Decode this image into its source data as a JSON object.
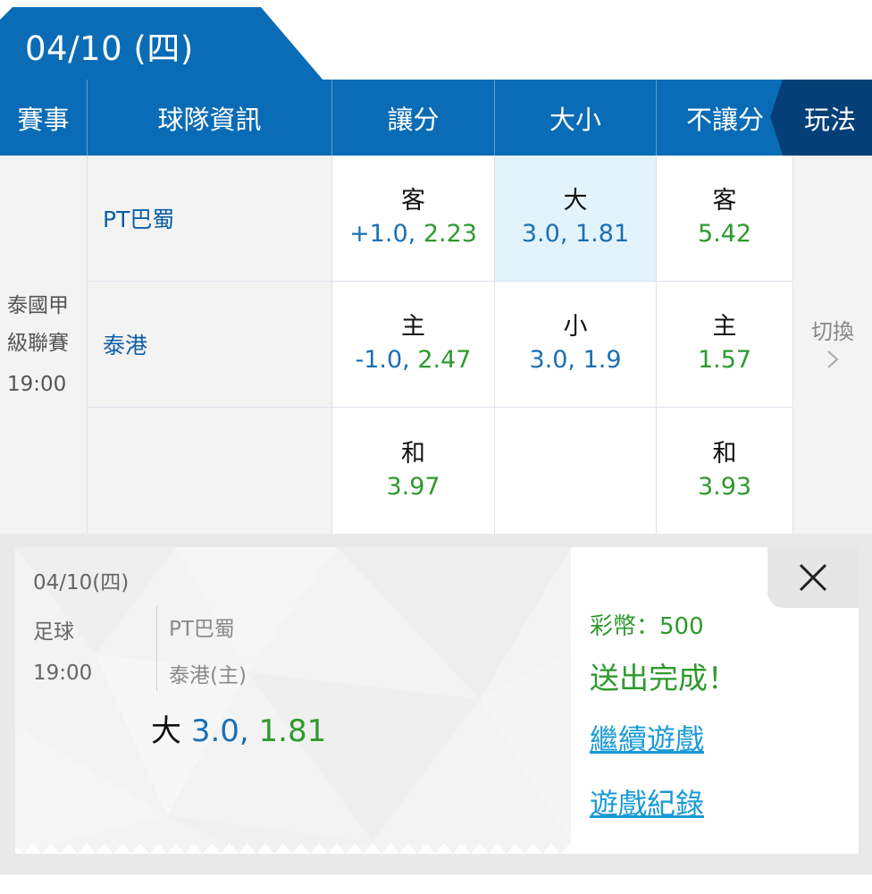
{
  "date_tab": {
    "label": "04/10 (四)"
  },
  "header": {
    "col_event": "賽事",
    "col_team": "球隊資訊",
    "col_handicap": "讓分",
    "col_total": "大小",
    "col_moneyline": "不讓分",
    "play_tab": "玩法"
  },
  "match": {
    "league_line1": "泰國甲",
    "league_line2": "級聯賽",
    "time": "19:00",
    "away_team": "PT巴蜀",
    "home_team": "泰港",
    "switch_label": "切換",
    "rows": [
      {
        "handicap": {
          "label": "客",
          "value_line": "+1.0,",
          "value_odd": "2.23"
        },
        "total": {
          "label": "大",
          "value_line": "3.0,",
          "value_odd": "1.81"
        },
        "moneyline": {
          "label": "客",
          "value_odd": "5.42"
        }
      },
      {
        "handicap": {
          "label": "主",
          "value_line": "-1.0,",
          "value_odd": "2.47"
        },
        "total": {
          "label": "小",
          "value_line": "3.0,",
          "value_odd": "1.9"
        },
        "moneyline": {
          "label": "主",
          "value_odd": "1.57"
        }
      },
      {
        "handicap": {
          "label": "和",
          "value_odd": "3.97"
        },
        "moneyline": {
          "label": "和",
          "value_odd": "3.93"
        }
      }
    ]
  },
  "receipt": {
    "date": "04/10(四)",
    "sport": "足球",
    "time": "19:00",
    "away_team": "PT巴蜀",
    "home_team": "泰港(主)",
    "bet_pick": "大",
    "bet_line": "3.0,",
    "bet_odd": "1.81",
    "coins": "彩幣：500",
    "status": "送出完成！",
    "continue_link": "繼續遊戲",
    "history_link": "遊戲紀錄"
  },
  "colors": {
    "primary_blue": "#0a6cb6",
    "play_tab_navy": "#053f78",
    "odds_green": "#2d9a2d",
    "line_blue": "#1a6fb4",
    "selected_bg": "#e3f3fc",
    "link_blue": "#1a9ad6"
  }
}
